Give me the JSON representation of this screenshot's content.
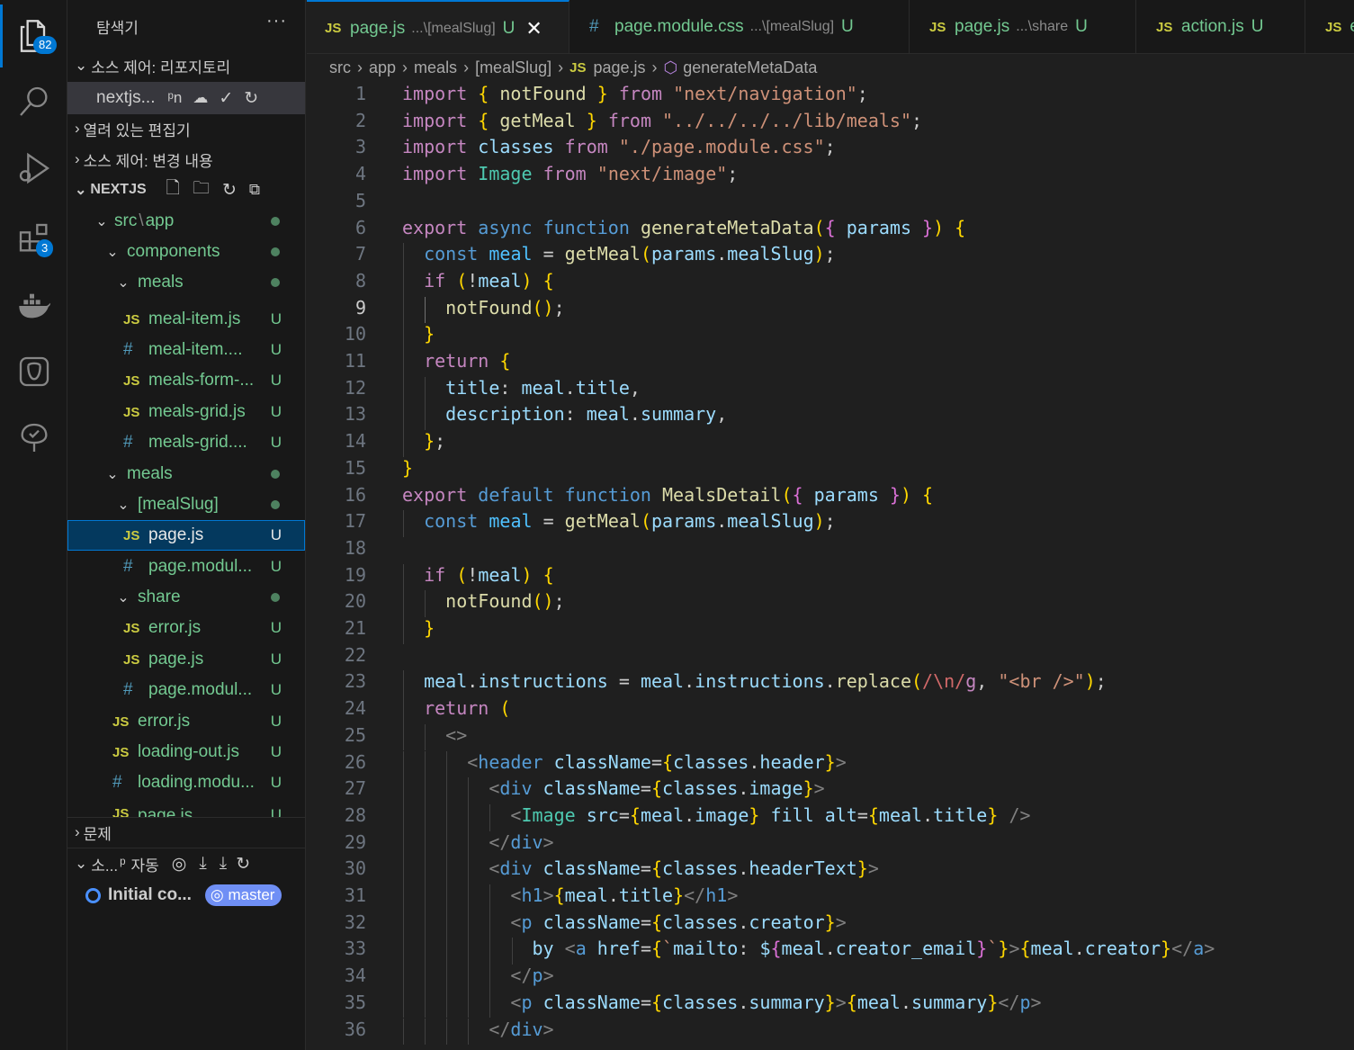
{
  "activity": {
    "explorer_badge": "82",
    "extensions_badge": "3"
  },
  "sidebar": {
    "title": "탐색기",
    "more": "···",
    "source_control_repos": "소스 제어: 리포지토리",
    "repo_name": "nextjs...",
    "repo_branch_icon": "ᵖn",
    "open_editors": "열려 있는 편집기",
    "source_control_changes": "소스 제어: 변경 내용",
    "project": "NEXTJS",
    "tree": [
      {
        "label": "src",
        "label2": "app",
        "kind": "folder"
      },
      {
        "label": "components",
        "kind": "folder"
      },
      {
        "label": "meals",
        "kind": "folder"
      },
      {
        "label": "meal-item.js",
        "kind": "js",
        "status": "U"
      },
      {
        "label": "meal-item....",
        "kind": "css",
        "status": "U"
      },
      {
        "label": "meals-form-...",
        "kind": "js",
        "status": "U"
      },
      {
        "label": "meals-grid.js",
        "kind": "js",
        "status": "U"
      },
      {
        "label": "meals-grid....",
        "kind": "css",
        "status": "U"
      },
      {
        "label": "meals",
        "kind": "folder"
      },
      {
        "label": "[mealSlug]",
        "kind": "folder"
      },
      {
        "label": "page.js",
        "kind": "js",
        "status": "U"
      },
      {
        "label": "page.modul...",
        "kind": "css",
        "status": "U"
      },
      {
        "label": "share",
        "kind": "folder"
      },
      {
        "label": "error.js",
        "kind": "js",
        "status": "U"
      },
      {
        "label": "page.js",
        "kind": "js",
        "status": "U"
      },
      {
        "label": "page.modul...",
        "kind": "css",
        "status": "U"
      },
      {
        "label": "error.js",
        "kind": "js",
        "status": "U"
      },
      {
        "label": "loading-out.js",
        "kind": "js",
        "status": "U"
      },
      {
        "label": "loading.modu...",
        "kind": "css",
        "status": "U"
      },
      {
        "label": "page.js",
        "kind": "js",
        "status": "U"
      }
    ],
    "problems": "문제",
    "graph_title": "소...",
    "graph_auto": "자동",
    "commit_message": "Initial co...",
    "branch": "master"
  },
  "tabs": [
    {
      "icon": "JS",
      "name": "page.js",
      "desc": "...\\[mealSlug]",
      "status": "U",
      "close": "✕"
    },
    {
      "icon": "#",
      "name": "page.module.css",
      "desc": "...\\[mealSlug]",
      "status": "U"
    },
    {
      "icon": "JS",
      "name": "page.js",
      "desc": "...\\share",
      "status": "U"
    },
    {
      "icon": "JS",
      "name": "action.js",
      "desc": "",
      "status": "U"
    },
    {
      "icon": "JS",
      "name": "e",
      "desc": "",
      "status": ""
    }
  ],
  "breadcrumbs": [
    "src",
    "app",
    "meals",
    "[mealSlug]",
    "page.js",
    "generateMetaData"
  ],
  "breadcrumb_js": "JS",
  "editor": {
    "current_line": 9,
    "lines": [
      "import { notFound } from \"next/navigation\";",
      "import { getMeal } from \"../../../../lib/meals\";",
      "import classes from \"./page.module.css\";",
      "import Image from \"next/image\";",
      "",
      "export async function generateMetaData({ params }) {",
      "  const meal = getMeal(params.mealSlug);",
      "  if (!meal) {",
      "    notFound();",
      "  }",
      "  return {",
      "    title: meal.title,",
      "    description: meal.summary,",
      "  };",
      "}",
      "export default function MealsDetail({ params }) {",
      "  const meal = getMeal(params.mealSlug);",
      "",
      "  if (!meal) {",
      "    notFound();",
      "  }",
      "",
      "  meal.instructions = meal.instructions.replace(/\\n/g, \"<br />\");",
      "  return (",
      "    <>",
      "      <header className={classes.header}>",
      "        <div className={classes.image}>",
      "          <Image src={meal.image} fill alt={meal.title} />",
      "        </div>",
      "        <div className={classes.headerText}>",
      "          <h1>{meal.title}</h1>",
      "          <p className={classes.creator}>",
      "            by <a href={`mailto: ${meal.creator_email}`}>{meal.creator}</a>",
      "          </p>",
      "          <p className={classes.summary}>{meal.summary}</p>",
      "        </div>"
    ]
  }
}
